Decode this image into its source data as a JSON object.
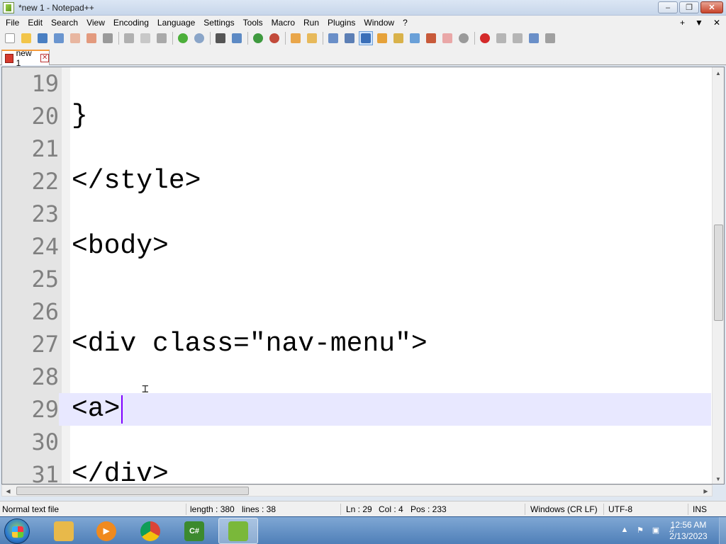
{
  "window": {
    "title": "*new 1 - Notepad++"
  },
  "menu": [
    "File",
    "Edit",
    "Search",
    "View",
    "Encoding",
    "Language",
    "Settings",
    "Tools",
    "Macro",
    "Run",
    "Plugins",
    "Window",
    "?"
  ],
  "menu_right": [
    "+",
    "▼",
    "✕"
  ],
  "tabs": [
    {
      "label": "new 1",
      "close": "✕"
    }
  ],
  "editor": {
    "lines": [
      {
        "num": "19",
        "code": ""
      },
      {
        "num": "20",
        "code": "}"
      },
      {
        "num": "21",
        "code": ""
      },
      {
        "num": "22",
        "code": "</style>"
      },
      {
        "num": "23",
        "code": ""
      },
      {
        "num": "24",
        "code": "<body>"
      },
      {
        "num": "25",
        "code": ""
      },
      {
        "num": "26",
        "code": ""
      },
      {
        "num": "27",
        "code": "<div class=\"nav-menu\">"
      },
      {
        "num": "28",
        "code": ""
      },
      {
        "num": "29",
        "code": "<a>"
      },
      {
        "num": "30",
        "code": ""
      },
      {
        "num": "31",
        "code": "</div>"
      }
    ]
  },
  "status": {
    "file_type": "Normal text file",
    "length": "length : 380",
    "lines": "lines : 38",
    "ln": "Ln : 29",
    "col": "Col : 4",
    "pos": "Pos : 233",
    "eol": "Windows (CR LF)",
    "encoding": "UTF-8",
    "mode": "INS"
  },
  "taskbar": {
    "apps": [
      {
        "name": "file-explorer",
        "color": "#e8b94a"
      },
      {
        "name": "media-player",
        "color": "#f08a1e"
      },
      {
        "name": "chrome",
        "color": "#d94a3a"
      },
      {
        "name": "csharp",
        "label": "C#",
        "color": "#3c8a2e"
      },
      {
        "name": "notepadpp",
        "color": "#7ab83a"
      }
    ],
    "time": "12:56 AM",
    "date": "2/13/2023"
  },
  "colors": {
    "current_line": "#e8e8ff",
    "caret": "#8000ff",
    "gutter_text": "#808080",
    "tab_accent": "#f59a3a"
  }
}
